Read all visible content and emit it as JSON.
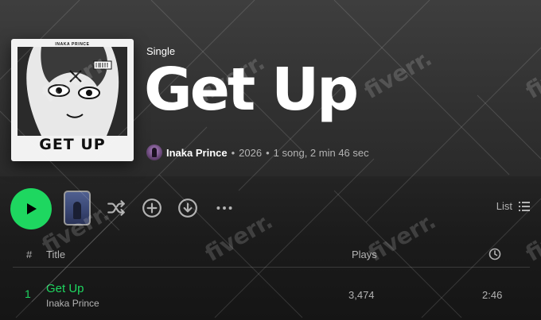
{
  "album": {
    "cover_artist": "INAKA PRINCE",
    "cover_title": "GET UP",
    "type": "Single",
    "title": "Get Up",
    "artist": "Inaka Prince",
    "year": "2026",
    "summary": "1 song, 2 min 46 sec"
  },
  "controls": {
    "view_label": "List",
    "icons": [
      "play-icon",
      "shuffle-icon",
      "add-icon",
      "download-icon",
      "more-icon",
      "list-icon"
    ]
  },
  "table": {
    "headers": {
      "number": "#",
      "title": "Title",
      "plays": "Plays",
      "duration_icon": "clock-icon"
    },
    "tracks": [
      {
        "number": "1",
        "title": "Get Up",
        "artist": "Inaka Prince",
        "plays": "3,474",
        "duration": "2:46"
      }
    ]
  },
  "watermark": "fiverr.",
  "colors": {
    "accent": "#1ed760",
    "secondary_text": "#b3b3b3",
    "background": "#121212"
  }
}
